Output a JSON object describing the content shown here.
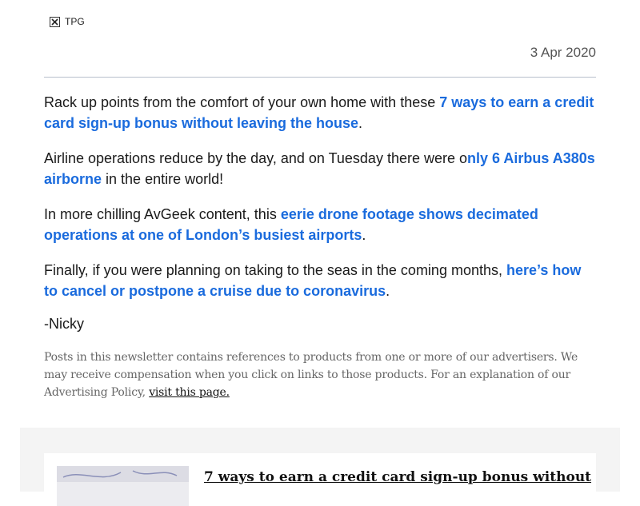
{
  "header": {
    "logo_alt": "TPG",
    "date": "3 Apr 2020"
  },
  "paragraphs": [
    {
      "pre": "Rack up points from the comfort of your own home with these ",
      "link": "7 ways to earn a credit card sign-up bonus without leaving the house",
      "post": "."
    },
    {
      "pre": "Airline operations reduce by the day, and on Tuesday there were o",
      "link": "nly 6 Airbus A380s airborne",
      "post": " in the entire world!"
    },
    {
      "pre": "In more chilling AvGeek content, this ",
      "link": "eerie drone footage shows decimated operations at one of London’s busiest airports",
      "post": "."
    },
    {
      "pre": "Finally, if you were planning on taking to the seas in the coming months, ",
      "link": "here’s how to cancel or postpone a cruise due to coronavirus",
      "post": "."
    }
  ],
  "signature": "-Nicky",
  "disclaimer": {
    "text": "Posts in this newsletter contains references to products from one or more of our advertisers. We may receive compensation when you click on links to those products. For an explanation of our Advertising Policy, ",
    "link": "visit this page."
  },
  "card": {
    "title": "7 ways to earn a credit card sign-up bonus without"
  },
  "colors": {
    "link": "#1a6bdd",
    "panel_bg": "#f4f4f4",
    "divider": "#b8c0cc"
  }
}
